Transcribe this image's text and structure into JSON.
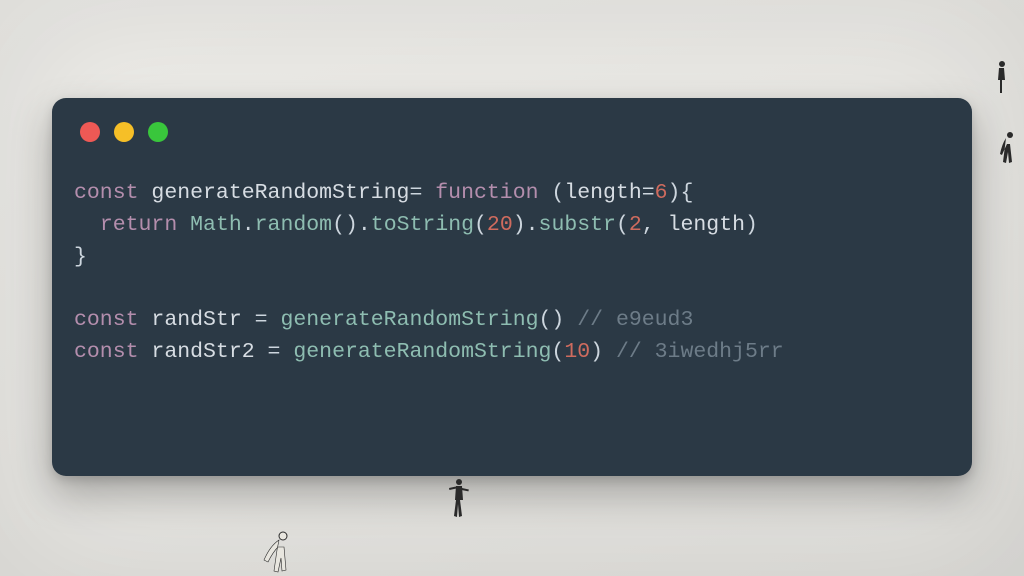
{
  "window": {
    "traffic_lights": [
      "red",
      "yellow",
      "green"
    ]
  },
  "code": {
    "line1": {
      "const": "const",
      "name": "generateRandomString",
      "eq": "=",
      "function": "function",
      "params_open": "(",
      "param": "length",
      "assign": "=",
      "default_val": "6",
      "params_close": "){"
    },
    "line2": {
      "indent": "  ",
      "return": "return",
      "math": "Math",
      "dot1": ".",
      "random": "random",
      "call1": "().",
      "toString": "toString",
      "open2": "(",
      "arg_20": "20",
      "close2": ").",
      "substr": "substr",
      "open3": "(",
      "arg_2": "2",
      "comma": ", ",
      "arg_len": "length",
      "close3": ")"
    },
    "line3": {
      "brace": "}"
    },
    "line5": {
      "const": "const",
      "name": "randStr",
      "eq": " = ",
      "call": "generateRandomString",
      "args": "()",
      "comment": "// e9eud3"
    },
    "line6": {
      "const": "const",
      "name": "randStr2",
      "eq": " = ",
      "call": "generateRandomString",
      "open": "(",
      "arg": "10",
      "close": ")",
      "comment": "// 3iwedhj5rr"
    }
  }
}
